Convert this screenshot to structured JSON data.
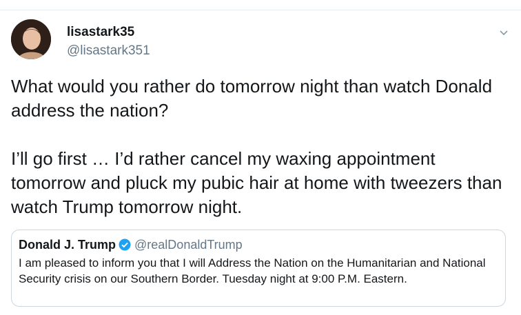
{
  "tweet": {
    "author_name": "lisastark35",
    "author_handle": "@lisastark351",
    "text_paragraph_1": "What would you rather do tomorrow night than watch Donald address the nation?",
    "text_paragraph_2": "I’ll go first … I’d rather cancel my waxing appointment tomorrow and pluck my pubic hair at home with tweezers than watch Trump tomorrow night.",
    "menu_icon": "chevron-down-icon"
  },
  "quoted_tweet": {
    "author_name": "Donald J. Trump",
    "author_handle": "@realDonaldTrump",
    "verified_icon": "verified-badge-icon",
    "text": "I am pleased to inform you that I will Address the Nation on the Humanitarian and National Security crisis on our Southern Border. Tuesday night at 9:00 P.M. Eastern."
  },
  "colors": {
    "text": "#14171a",
    "secondary_text": "#657786",
    "border": "#ccd6dd",
    "verified_blue": "#1da1f2"
  }
}
